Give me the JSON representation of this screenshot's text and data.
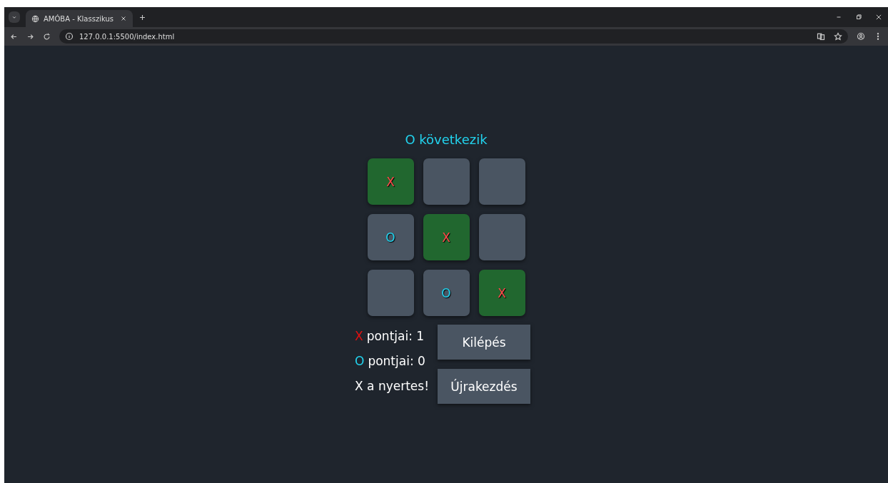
{
  "browser": {
    "tab_title": "AMÓBA - Klasszikus",
    "url": "127.0.0.1:5500/index.html"
  },
  "status": "O következik",
  "cells": [
    {
      "mark": "X",
      "winning": true
    },
    {
      "winning": false
    },
    {
      "winning": false
    },
    {
      "mark": "O",
      "winning": false
    },
    {
      "mark": "X",
      "winning": true
    },
    {
      "winning": false
    },
    {
      "winning": false
    },
    {
      "mark": "O",
      "winning": false
    },
    {
      "mark": "X",
      "winning": true
    }
  ],
  "scores": [
    {
      "symbol": "X",
      "color": "#e01010",
      "text": "pontjai: 1"
    },
    {
      "symbol": "O",
      "color": "#22d3ee",
      "text": "pontjai: 0"
    }
  ],
  "result": "X a nyertes!",
  "buttons": [
    "Kilépés",
    "Újrakezdés"
  ]
}
